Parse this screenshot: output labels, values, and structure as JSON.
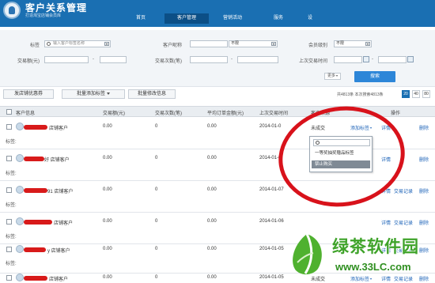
{
  "header": {
    "title": "客户关系管理",
    "subtitle": "打造淘宝店铺会员库",
    "nav": [
      "首页",
      "客户管理",
      "营销活动",
      "服务",
      "设"
    ]
  },
  "filters": {
    "tag_label": "标签",
    "tag_placeholder": "输入客户标签名称",
    "name_label": "客户昵称",
    "unlimited": "不限",
    "level_label": "会员级别",
    "amount_label": "交易额(元)",
    "count_label": "交易次数(笔)",
    "last_time_label": "上次交易时间",
    "dash": "-",
    "more": "更多",
    "search": "搜索"
  },
  "toolbar": {
    "btn_coupon": "发店铺优惠券",
    "btn_add_tag": "批量添加标签",
    "btn_edit": "批量修改信息",
    "pager_info": "共4813条 本次搜索4813条",
    "page_sizes": [
      "20",
      "40",
      "80"
    ],
    "active_page_size": "20"
  },
  "table": {
    "headers": [
      "客户信息",
      "交易额(元)",
      "交易次数(笔)",
      "平均订单金额(元)",
      "上次交易时间",
      "客户来源",
      "操作"
    ],
    "tag_label": "标签:",
    "rows": [
      {
        "name": "店铺客户",
        "amount": "0.00",
        "count": "0",
        "avg": "0.00",
        "date": "2014-01-0",
        "source": "未成交",
        "add_tag": "添加标签",
        "detail": "详情",
        "record": "",
        "delete": "删除"
      },
      {
        "name": "好 店铺客户",
        "amount": "0.00",
        "count": "0",
        "avg": "0.00",
        "date": "2014-01-0",
        "source": "",
        "add_tag": "",
        "detail": "详情",
        "record": "",
        "delete": "删除"
      },
      {
        "name": "91 店铺客户",
        "amount": "0.00",
        "count": "0",
        "avg": "0.00",
        "date": "2014-01-07",
        "source": "",
        "add_tag": "",
        "detail": "详情",
        "record": "交易记录",
        "delete": "删除"
      },
      {
        "name": "店铺客户",
        "amount": "0.00",
        "count": "0",
        "avg": "0.00",
        "date": "2014-01-06",
        "source": "",
        "add_tag": "",
        "detail": "详情",
        "record": "交易记录",
        "delete": "删除"
      },
      {
        "name": "y 店铺客户",
        "amount": "0.00",
        "count": "0",
        "avg": "0.00",
        "date": "2014-01-05",
        "source": "",
        "add_tag": "",
        "detail": "详情",
        "record": "交易记录",
        "delete": "删除"
      },
      {
        "name": "店铺客户",
        "amount": "0.00",
        "count": "0",
        "avg": "0.00",
        "date": "2014-01-05",
        "source": "未成交",
        "add_tag": "添加标签",
        "detail": "详情",
        "record": "交易记录",
        "delete": "删除"
      }
    ]
  },
  "tag_popup": {
    "items": [
      "一等奖抽奖赠品标签",
      "禁止购买"
    ],
    "selected": "禁止购买"
  },
  "watermark": {
    "name": "绿茶软件园",
    "url": "www.33LC.com"
  },
  "colors": {
    "header_bg": "#1a6fb2",
    "annotation": "#d8121b",
    "link": "#1d63b8",
    "watermark_green": "#3fa32a"
  }
}
